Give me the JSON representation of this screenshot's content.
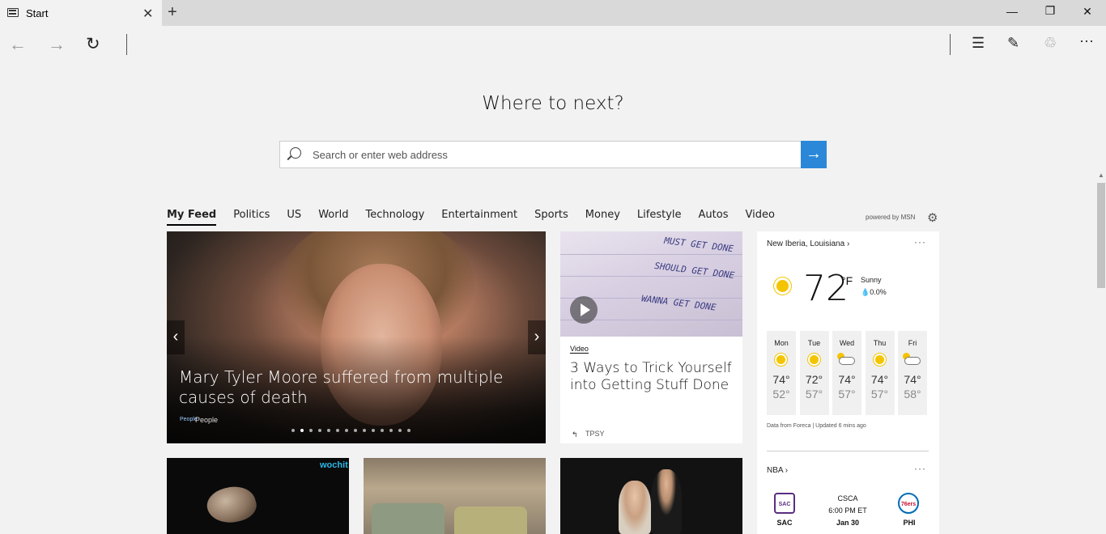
{
  "tab": {
    "title": "Start"
  },
  "hero": {
    "title": "Where to next?",
    "search_placeholder": "Search or enter web address"
  },
  "categories": [
    "My Feed",
    "Politics",
    "US",
    "World",
    "Technology",
    "Entertainment",
    "Sports",
    "Money",
    "Lifestyle",
    "Autos",
    "Video"
  ],
  "powered_by": "powered by MSN",
  "main_story": {
    "headline": "Mary Tyler Moore suffered from multiple causes of death",
    "source_logo": "People",
    "source": "People",
    "slide_count": 14,
    "active_slide": 2
  },
  "video_story": {
    "tag": "Video",
    "headline": "3 Ways to Trick Yourself into Getting Stuff Done",
    "source": "TPSY",
    "notebook_lines": [
      "MUST GET DONE",
      "SHOULD GET DONE",
      "WANNA GET DONE"
    ]
  },
  "weather": {
    "location": "New Iberia, Louisiana",
    "temp": "72",
    "unit": "°F",
    "condition": "Sunny",
    "precip": "0.0%",
    "forecast": [
      {
        "day": "Mon",
        "hi": "74°",
        "lo": "52°",
        "icon": "sun-icon"
      },
      {
        "day": "Tue",
        "hi": "72°",
        "lo": "57°",
        "icon": "sun-icon"
      },
      {
        "day": "Wed",
        "hi": "74°",
        "lo": "57°",
        "icon": "partly-cloudy-icon"
      },
      {
        "day": "Thu",
        "hi": "74°",
        "lo": "57°",
        "icon": "sun-icon"
      },
      {
        "day": "Fri",
        "hi": "74°",
        "lo": "58°",
        "icon": "partly-cloudy-icon"
      }
    ],
    "credit": "Data from Foreca | Updated 6 mins ago"
  },
  "nba": {
    "label": "NBA",
    "home": {
      "abbr": "SAC",
      "logo_text": "SAC"
    },
    "away": {
      "abbr": "PHI",
      "logo_text": "76ers"
    },
    "network": "CSCA",
    "time": "6:00 PM ET",
    "date": "Jan 30"
  },
  "bottom_cards": {
    "video_brand": "wochit"
  },
  "colors": {
    "accent": "#2b88d8",
    "sun": "#f5c400",
    "kings": "#5a2d81",
    "sixers": "#006bb6"
  }
}
